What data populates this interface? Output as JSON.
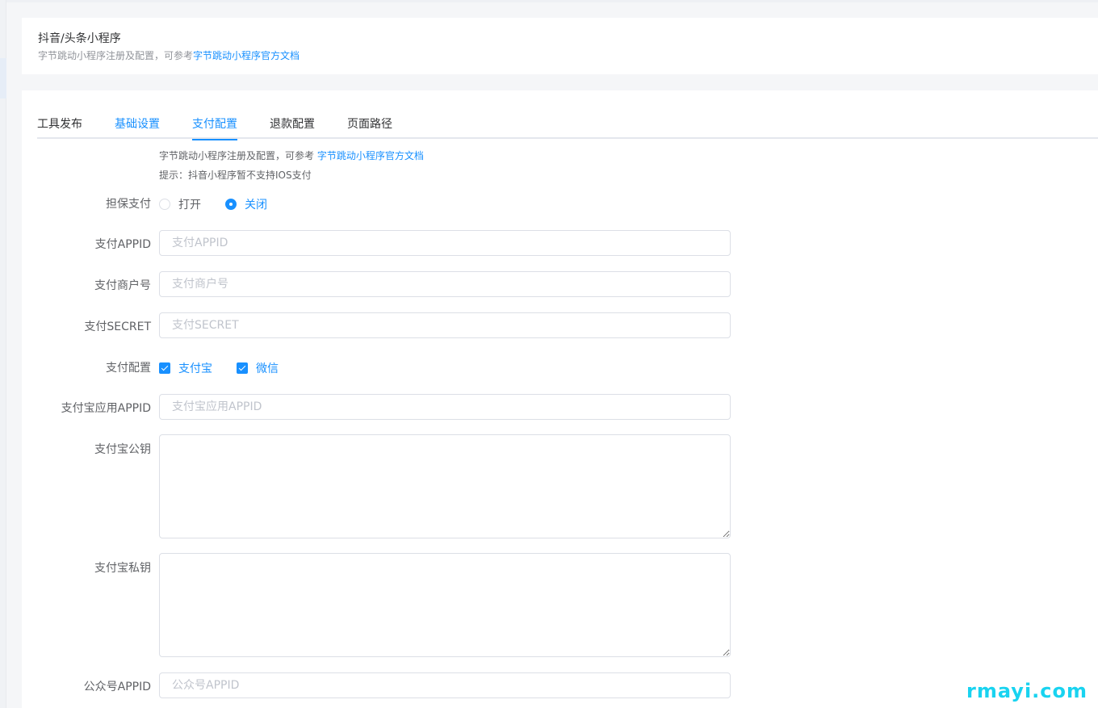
{
  "header": {
    "title": "抖音/头条小程序",
    "desc_prefix": "字节跳动小程序注册及配置，可参考",
    "desc_link": "字节跳动小程序官方文档"
  },
  "tabs": [
    {
      "label": "工具发布"
    },
    {
      "label": "基础设置"
    },
    {
      "label": "支付配置"
    },
    {
      "label": "退款配置"
    },
    {
      "label": "页面路径"
    }
  ],
  "notes": {
    "line1_prefix": "字节跳动小程序注册及配置，可参考 ",
    "line1_link": "字节跳动小程序官方文档",
    "line2": "提示：抖音小程序暂不支持IOS支付"
  },
  "form": {
    "guarantee": {
      "label": "担保支付",
      "options": [
        "打开",
        "关闭"
      ],
      "selected": "关闭"
    },
    "appid": {
      "label": "支付APPID",
      "placeholder": "支付APPID",
      "value": ""
    },
    "merchant": {
      "label": "支付商户号",
      "placeholder": "支付商户号",
      "value": ""
    },
    "secret": {
      "label": "支付SECRET",
      "placeholder": "支付SECRET",
      "value": ""
    },
    "pay_config": {
      "label": "支付配置",
      "options": [
        "支付宝",
        "微信"
      ],
      "checked": [
        "支付宝",
        "微信"
      ]
    },
    "alipay_appid": {
      "label": "支付宝应用APPID",
      "placeholder": "支付宝应用APPID",
      "value": ""
    },
    "alipay_public_key": {
      "label": "支付宝公钥",
      "value": ""
    },
    "alipay_private_key": {
      "label": "支付宝私钥",
      "value": ""
    },
    "mp_appid": {
      "label": "公众号APPID",
      "placeholder": "公众号APPID",
      "value": ""
    }
  },
  "colors": {
    "accent": "#1890ff",
    "watermark": "#19d3f0"
  },
  "watermark": "rmayi.com"
}
